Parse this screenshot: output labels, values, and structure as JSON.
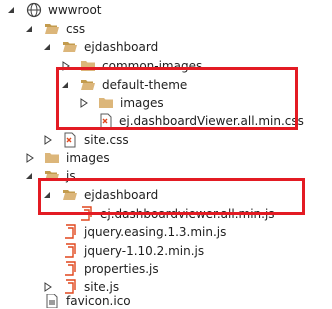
{
  "tree": {
    "wwwroot": "wwwroot",
    "css": "css",
    "css_ejdashboard": "ejdashboard",
    "common_images": "common-images",
    "default_theme": "default-theme",
    "default_theme_images": "images",
    "dashboard_css_file": "ej.dashboardViewer.all.min.css",
    "site_css": "site.css",
    "images": "images",
    "js": "js",
    "js_ejdashboard": "ejdashboard",
    "dashboard_js_file": "ej.dashboardviewer.all.min.js",
    "jquery_easing": "jquery.easing.1.3.min.js",
    "jquery": "jquery-1.10.2.min.js",
    "properties_js": "properties.js",
    "site_js": "site.js",
    "favicon": "favicon.ico"
  },
  "colors": {
    "highlight": "#e31b23",
    "folder": "#dcb67a",
    "file_icon": "#e0471d"
  }
}
